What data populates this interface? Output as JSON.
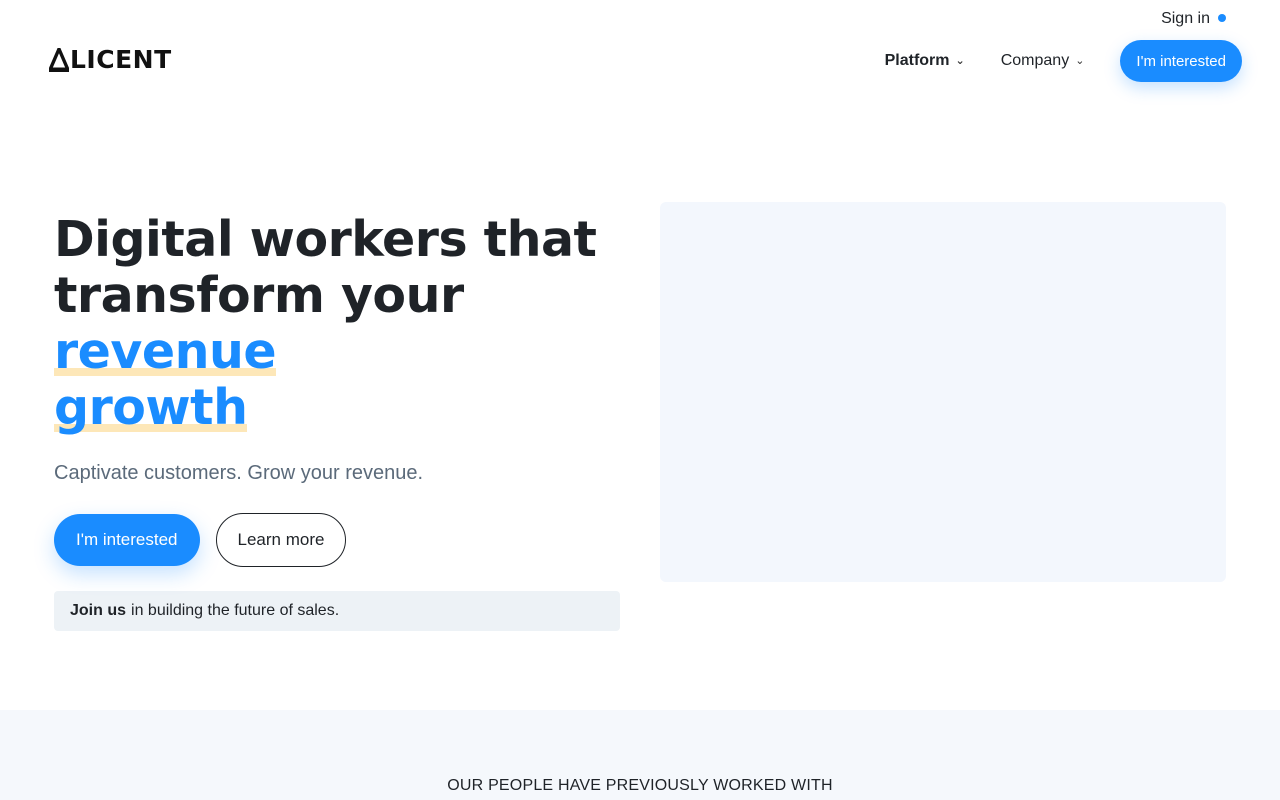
{
  "header": {
    "sign_in_label": "Sign in",
    "logo_text": "LICENT",
    "logo_mark": "triangle-a-logo",
    "nav": [
      {
        "label": "Platform",
        "icon": "chevron-down-icon"
      },
      {
        "label": "Company",
        "icon": "chevron-down-icon"
      }
    ],
    "cta_label": "I'm interested"
  },
  "hero": {
    "title_line1": "Digital workers that",
    "title_line2_plain": "transform your ",
    "title_highlight_1": "revenue",
    "title_highlight_2": "growth",
    "subtitle": "Captivate customers. Grow your revenue.",
    "primary_cta": "I'm interested",
    "secondary_cta": "Learn more",
    "banner_bold": "Join us",
    "banner_text": "in building the future of sales."
  },
  "logos": {
    "heading": "OUR PEOPLE HAVE PREVIOUSLY WORKED WITH"
  },
  "colors": {
    "accent": "#1a8cff",
    "highlight_underline": "#fde7b8",
    "subtitle": "#5b6a7a",
    "media_bg": "#f3f7fd"
  }
}
